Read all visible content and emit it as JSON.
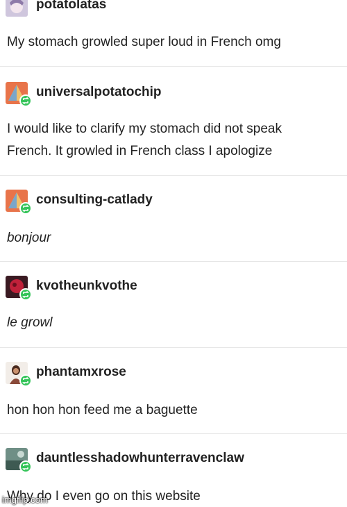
{
  "posts": [
    {
      "username": "potatolatas",
      "text": "My stomach growled super loud in French omg"
    },
    {
      "username": "universalpotatochip",
      "text_line1": "I would like to clarify my stomach did not speak",
      "text_line2": "French. It growled in French class I apologize"
    },
    {
      "username": "consulting-catlady",
      "text": "bonjour"
    },
    {
      "username": "kvotheunkvothe",
      "text": "le growl"
    },
    {
      "username": "phantamxrose",
      "text": "hon hon hon feed me a baguette"
    },
    {
      "username": "dauntlesshadowhunterravenclaw",
      "text": "Why do I even go on this website"
    }
  ],
  "watermark": "imgflip.com",
  "icons": {
    "reblog": "reblog-icon",
    "avatar": "avatar"
  },
  "colors": {
    "reblog_badge": "#35c45a",
    "separator": "#e6e6e6",
    "text": "#222222"
  }
}
